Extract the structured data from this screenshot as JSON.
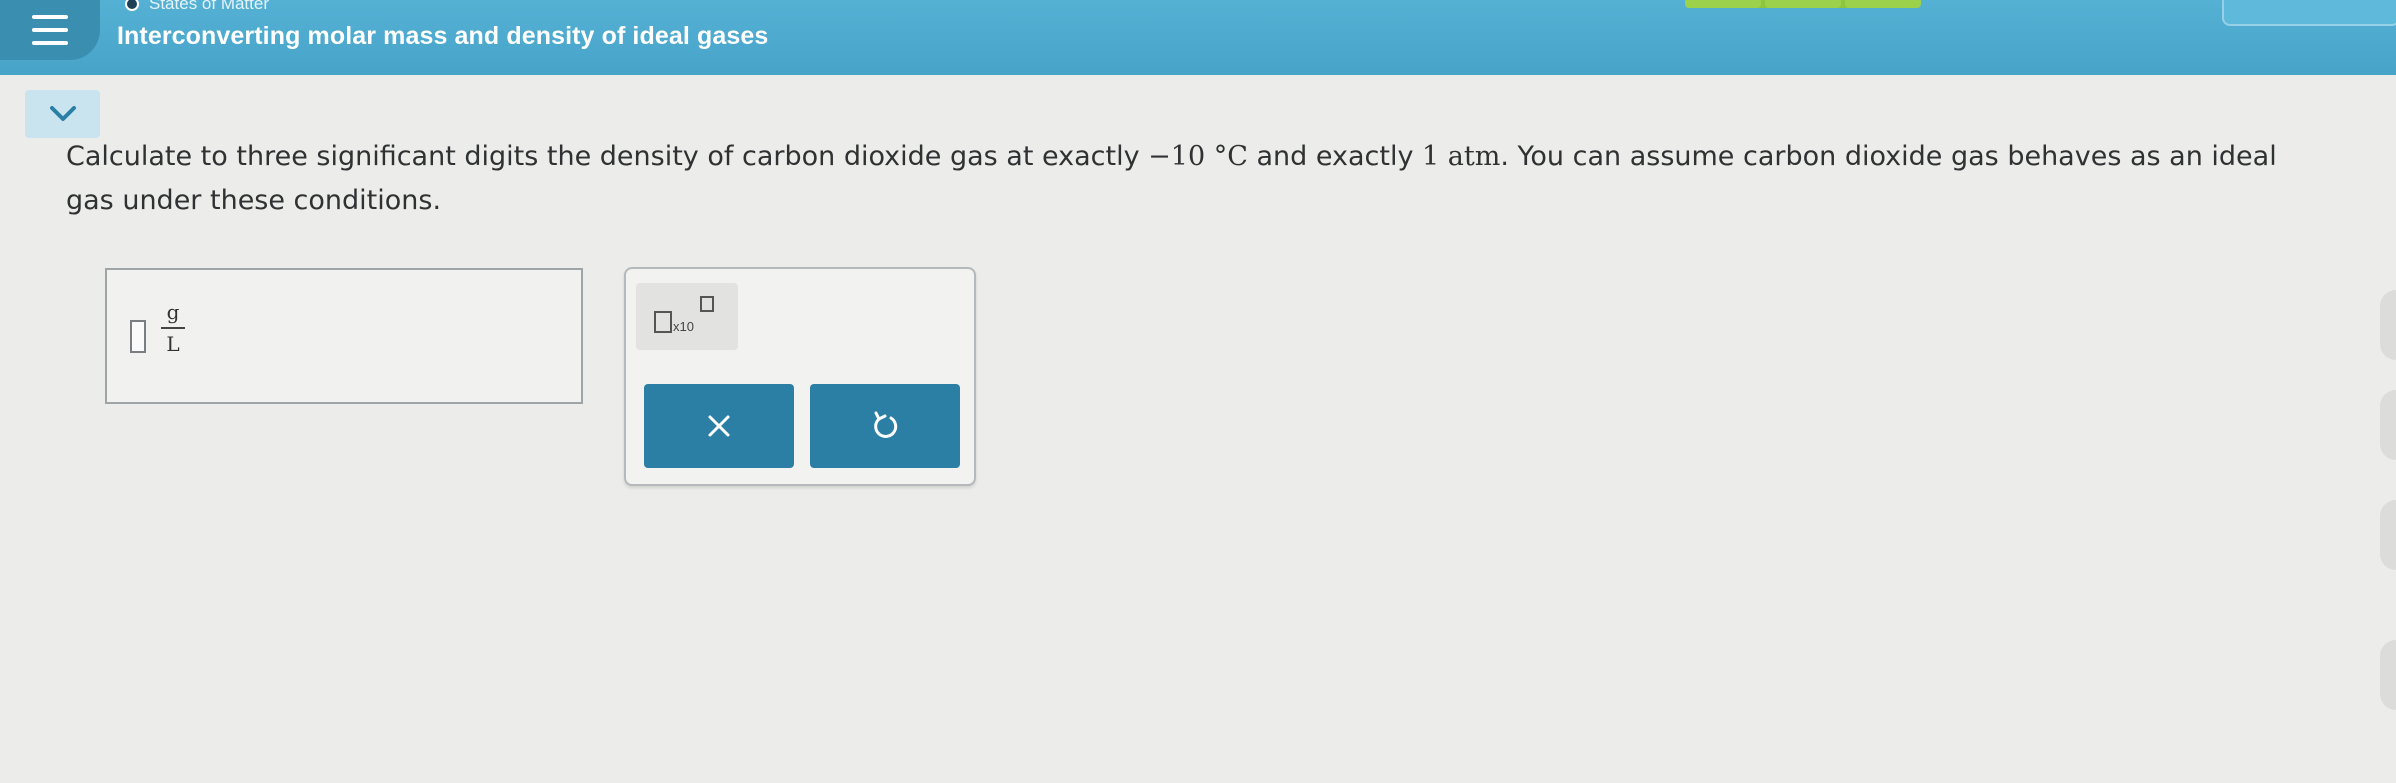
{
  "header": {
    "breadcrumb": "States of Matter",
    "topic_title": "Interconverting molar mass and density of ideal gases",
    "bar_color": "#4aa8cc"
  },
  "question": {
    "text_before": "Calculate to three significant digits the density of carbon dioxide gas at exactly ",
    "temperature": "−10 °C",
    "text_middle": " and exactly ",
    "pressure": "1 atm",
    "text_after": ". You can assume carbon dioxide gas behaves as an ideal gas under these conditions."
  },
  "answer": {
    "value": "",
    "unit_numerator": "g",
    "unit_denominator": "L"
  },
  "tools": {
    "sci_notation_label": "x10",
    "clear_icon": "✕",
    "undo_icon": "undo-icon"
  },
  "colors": {
    "accent": "#2b7ea4",
    "background": "#ecedea"
  }
}
